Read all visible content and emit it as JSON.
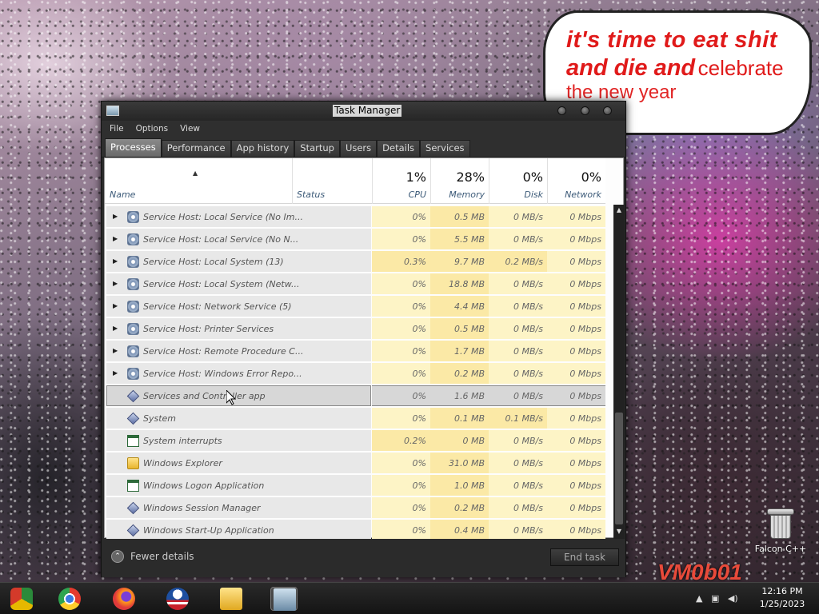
{
  "wallpaper": {
    "bubble_line1": "it's time to eat shit",
    "bubble_line2_bold": "and die and",
    "bubble_line2_light": "celebrate",
    "bubble_line3": "the new year",
    "watermark": "VM0b01"
  },
  "desktop_icons": [
    {
      "label": "Falcon C++",
      "icon": "recycle-bin-icon"
    }
  ],
  "window": {
    "title": "Task Manager",
    "menu": [
      "File",
      "Options",
      "View"
    ],
    "tabs": [
      "Processes",
      "Performance",
      "App history",
      "Startup",
      "Users",
      "Details",
      "Services"
    ],
    "active_tab": "Processes"
  },
  "columns": {
    "name": "Name",
    "status": "Status",
    "cpu": {
      "pct": "1%",
      "label": "CPU"
    },
    "memory": {
      "pct": "28%",
      "label": "Memory"
    },
    "disk": {
      "pct": "0%",
      "label": "Disk"
    },
    "network": {
      "pct": "0%",
      "label": "Network"
    }
  },
  "rows": [
    {
      "name": "Service Host: Local Service (No Im...",
      "icon": "gear",
      "expandable": true,
      "cpu": "0%",
      "memory": "0.5 MB",
      "disk": "0 MB/s",
      "network": "0 Mbps"
    },
    {
      "name": "Service Host: Local Service (No N...",
      "icon": "gear",
      "expandable": true,
      "cpu": "0%",
      "memory": "5.5 MB",
      "disk": "0 MB/s",
      "network": "0 Mbps"
    },
    {
      "name": "Service Host: Local System (13)",
      "icon": "gear",
      "expandable": true,
      "cpu": "0.3%",
      "memory": "9.7 MB",
      "disk": "0.2 MB/s",
      "network": "0 Mbps"
    },
    {
      "name": "Service Host: Local System (Netw...",
      "icon": "gear",
      "expandable": true,
      "cpu": "0%",
      "memory": "18.8 MB",
      "disk": "0 MB/s",
      "network": "0 Mbps"
    },
    {
      "name": "Service Host: Network Service (5)",
      "icon": "gear",
      "expandable": true,
      "cpu": "0%",
      "memory": "4.4 MB",
      "disk": "0 MB/s",
      "network": "0 Mbps"
    },
    {
      "name": "Service Host: Printer Services",
      "icon": "gear",
      "expandable": true,
      "cpu": "0%",
      "memory": "0.5 MB",
      "disk": "0 MB/s",
      "network": "0 Mbps"
    },
    {
      "name": "Service Host: Remote Procedure C...",
      "icon": "gear",
      "expandable": true,
      "cpu": "0%",
      "memory": "1.7 MB",
      "disk": "0 MB/s",
      "network": "0 Mbps"
    },
    {
      "name": "Service Host: Windows Error Repo...",
      "icon": "gear",
      "expandable": true,
      "cpu": "0%",
      "memory": "0.2 MB",
      "disk": "0 MB/s",
      "network": "0 Mbps"
    },
    {
      "name": "Services and Controller app",
      "icon": "diamond",
      "expandable": false,
      "selected": true,
      "cpu": "0%",
      "memory": "1.6 MB",
      "disk": "0 MB/s",
      "network": "0 Mbps"
    },
    {
      "name": "System",
      "icon": "diamond",
      "expandable": false,
      "cpu": "0%",
      "memory": "0.1 MB",
      "disk": "0.1 MB/s",
      "network": "0 Mbps"
    },
    {
      "name": "System interrupts",
      "icon": "window",
      "expandable": false,
      "cpu": "0.2%",
      "memory": "0 MB",
      "disk": "0 MB/s",
      "network": "0 Mbps"
    },
    {
      "name": "Windows Explorer",
      "icon": "folder",
      "expandable": false,
      "cpu": "0%",
      "memory": "31.0 MB",
      "disk": "0 MB/s",
      "network": "0 Mbps"
    },
    {
      "name": "Windows Logon Application",
      "icon": "window",
      "expandable": false,
      "cpu": "0%",
      "memory": "1.0 MB",
      "disk": "0 MB/s",
      "network": "0 Mbps"
    },
    {
      "name": "Windows Session Manager",
      "icon": "diamond",
      "expandable": false,
      "cpu": "0%",
      "memory": "0.2 MB",
      "disk": "0 MB/s",
      "network": "0 Mbps"
    },
    {
      "name": "Windows Start-Up Application",
      "icon": "diamond",
      "expandable": false,
      "cpu": "0%",
      "memory": "0.4 MB",
      "disk": "0 MB/s",
      "network": "0 Mbps"
    }
  ],
  "footer": {
    "fewer_details": "Fewer details",
    "end_task": "End task"
  },
  "taskbar": {
    "apps": [
      {
        "name": "chrome-variant-icon"
      },
      {
        "name": "chrome-icon"
      },
      {
        "name": "firefox-icon"
      },
      {
        "name": "obama-logo-icon"
      },
      {
        "name": "file-explorer-icon"
      },
      {
        "name": "task-manager-icon",
        "active": true
      }
    ],
    "time": "12:16 PM",
    "date": "1/25/2023"
  },
  "colors": {
    "cpu_high": "#fbe9a6",
    "cpu_low": "#fdf4c6",
    "bubble_text": "#e01a1a"
  }
}
